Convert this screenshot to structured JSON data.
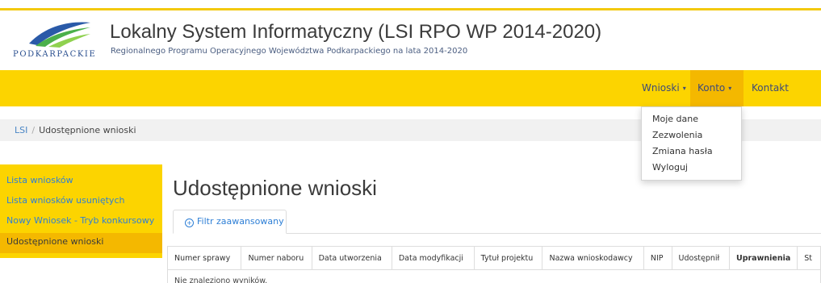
{
  "brand": {
    "logo_text": "PODKARPACKIE",
    "title": "Lokalny System Informatyczny (LSI RPO WP 2014-2020)",
    "subtitle": "Regionalnego Programu Operacyjnego Województwa Podkarpackiego na lata 2014-2020",
    "colors": {
      "accent": "#fcd400",
      "accent_dark": "#f4b800",
      "link": "#2e7fd6"
    }
  },
  "navbar": {
    "items": [
      {
        "label": "Wnioski",
        "caret": "▾"
      },
      {
        "label": "Konto",
        "caret": "▾"
      },
      {
        "label": "Kontakt"
      }
    ]
  },
  "account_menu": {
    "items": [
      "Moje dane",
      "Zezwolenia",
      "Zmiana hasła",
      "Wyloguj"
    ]
  },
  "breadcrumb": {
    "root": "LSI",
    "separator": "/",
    "current": "Udostępnione wnioski"
  },
  "sidebar": {
    "items": [
      "Lista wniosków",
      "Lista wniosków usuniętych",
      "Nowy Wniosek - Tryb konkursowy",
      "Udostępnione wnioski"
    ]
  },
  "page": {
    "heading": "Udostępnione wnioski",
    "tab_label": "Filtr zaawansowany",
    "tab_icon": "plus-circle-icon"
  },
  "table": {
    "columns": [
      "Numer sprawy",
      "Numer naboru",
      "Data utworzenia",
      "Data modyfikacji",
      "Tytuł projektu",
      "Nazwa wnioskodawcy",
      "NIP",
      "Udostępnił",
      "Uprawnienia",
      "St"
    ],
    "empty_message": "Nie znaleziono wyników."
  }
}
